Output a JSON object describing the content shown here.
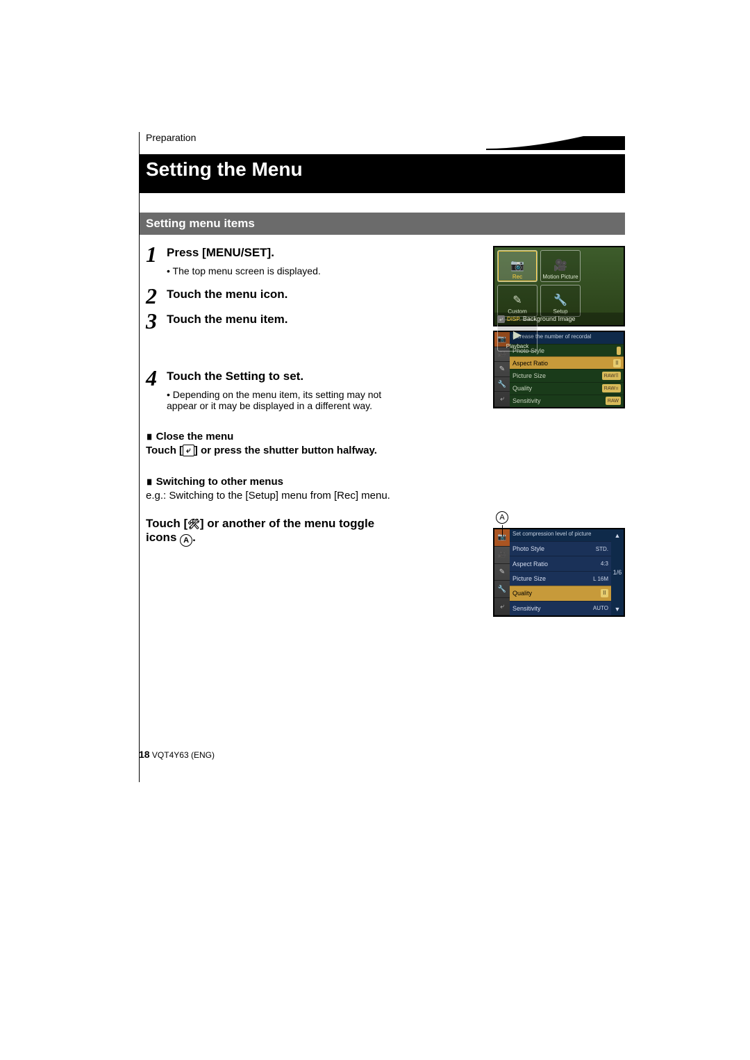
{
  "breadcrumb": "Preparation",
  "page_title": "Setting the Menu",
  "section_title": "Setting menu items",
  "steps": [
    {
      "num": "1",
      "head": "Press [MENU/SET].",
      "bullet": "The top menu screen is displayed."
    },
    {
      "num": "2",
      "head": "Touch the menu icon."
    },
    {
      "num": "3",
      "head": "Touch the menu item."
    },
    {
      "num": "4",
      "head": "Touch the Setting to set.",
      "bullet": "Depending on the menu item, its setting may not appear or it may be displayed in a different way."
    }
  ],
  "close_menu_h": "Close the menu",
  "close_menu_line_a": "Touch [",
  "close_menu_line_b": "] or press the shutter button halfway.",
  "switch_h": "Switching to other menus",
  "switch_eg": "e.g.: Switching to the [Setup] menu from [Rec] menu.",
  "touch_toggle_a": "Touch [",
  "touch_toggle_b": "] or another of the menu toggle icons ",
  "touch_toggle_c": ".",
  "back_glyph": "⤶",
  "wrench_glyph": "🛠",
  "circ_a": "A",
  "footer": {
    "page": "18",
    "code": "VQT4Y63 (ENG)"
  },
  "shot_a": {
    "tiles": [
      "Rec",
      "Motion Picture",
      "Custom",
      "Setup",
      "Playback"
    ],
    "bar_back": "⤶",
    "bar_disp": "DISP.",
    "bar_text": "Background Image"
  },
  "shot_b": {
    "header": "Increase the number of recordal",
    "side_icons": [
      "📷",
      "🎥",
      "✎",
      "🔧",
      "⤶"
    ],
    "rows": [
      {
        "label": "Photo Style",
        "val": ""
      },
      {
        "label": "Aspect Ratio",
        "val": "",
        "sel": true,
        "pill": "⠿"
      },
      {
        "label": "Picture Size",
        "val": "RAW⠿"
      },
      {
        "label": "Quality",
        "val": "RAW⠶"
      },
      {
        "label": "Sensitivity",
        "val": "RAW"
      }
    ]
  },
  "shot_c": {
    "header": "Set compression level of picture",
    "side_icons": [
      "📷",
      "🎥",
      "✎",
      "🔧",
      "⤶"
    ],
    "rows": [
      {
        "label": "Photo Style",
        "val": "STD."
      },
      {
        "label": "Aspect Ratio",
        "val": "4:3"
      },
      {
        "label": "Picture Size",
        "val": "L 16M"
      },
      {
        "label": "Quality",
        "val": "⠿",
        "sel": true
      },
      {
        "label": "Sensitivity",
        "val": "AUTO"
      }
    ],
    "scroll_top": "▲",
    "scroll_mid": "1/6",
    "scroll_bot": "▼"
  }
}
